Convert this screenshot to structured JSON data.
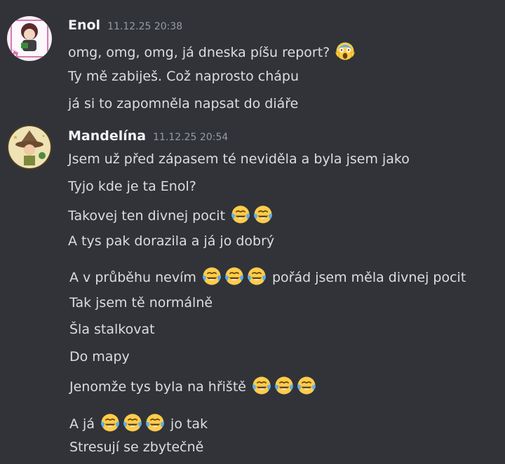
{
  "messages": [
    {
      "author": "Enol",
      "timestamp": "11.12.25 20:38",
      "lines": [
        {
          "parts": [
            {
              "t": "omg, omg, omg, já dneska píšu report?"
            },
            {
              "emoji": "scream-emoji"
            }
          ]
        },
        {
          "parts": [
            {
              "t": "Ty mě zabiješ. Což naprosto chápu"
            }
          ]
        },
        {
          "parts": [
            {
              "t": "já si to zapomněla napsat do diáře"
            }
          ]
        }
      ]
    },
    {
      "author": "Mandelína",
      "timestamp": "11.12.25 20:54",
      "lines": [
        {
          "parts": [
            {
              "t": "Jsem už před zápasem té neviděla a byla jsem jako"
            }
          ]
        },
        {
          "parts": [
            {
              "t": "Tyjo kde je ta Enol?"
            }
          ]
        },
        {
          "parts": [
            {
              "t": "Takovej ten divnej pocit"
            },
            {
              "emoji": "joy-emoji"
            },
            {
              "emoji": "joy-emoji"
            }
          ]
        },
        {
          "parts": [
            {
              "t": "A tys pak dorazila a já jo dobrý"
            }
          ]
        },
        {
          "parts": [
            {
              "t": "A v průběhu nevím"
            },
            {
              "emoji": "joy-emoji"
            },
            {
              "emoji": "joy-emoji"
            },
            {
              "emoji": "joy-emoji"
            },
            {
              "t": "pořád jsem měla divnej pocit"
            }
          ]
        },
        {
          "parts": [
            {
              "t": "Tak jsem tě normálně"
            }
          ]
        },
        {
          "parts": [
            {
              "t": "Šla stalkovat"
            }
          ]
        },
        {
          "parts": [
            {
              "t": "Do mapy"
            }
          ]
        },
        {
          "parts": [
            {
              "t": "Jenomže tys byla na hřiště"
            },
            {
              "emoji": "joy-emoji"
            },
            {
              "emoji": "joy-emoji"
            },
            {
              "emoji": "joy-emoji"
            }
          ]
        },
        {
          "parts": [
            {
              "t": "A já"
            },
            {
              "emoji": "joy-emoji"
            },
            {
              "emoji": "joy-emoji"
            },
            {
              "emoji": "joy-emoji"
            },
            {
              "t": "jo tak"
            }
          ]
        },
        {
          "parts": [
            {
              "t": "Stresují se zbytečně"
            }
          ]
        }
      ]
    }
  ],
  "colors": {
    "background": "#313338",
    "author": "#f2f3f5",
    "timestamp": "#949ba4",
    "text": "#dbdee1"
  }
}
